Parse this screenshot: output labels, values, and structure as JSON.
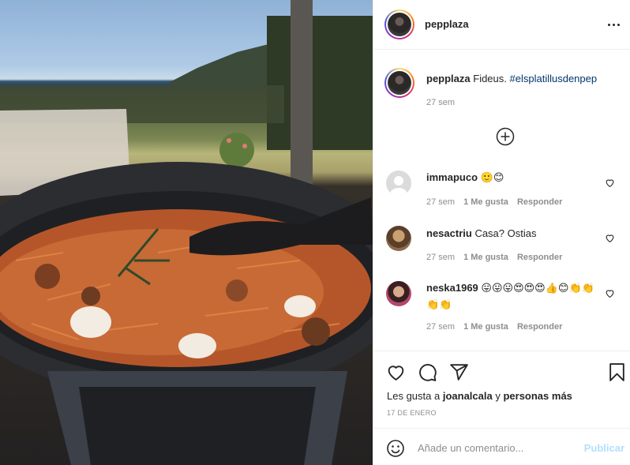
{
  "post": {
    "author": "pepplaza",
    "caption_text": "Fideus.",
    "caption_hashtag": "#elsplatillusdenpep",
    "caption_time": "27 sem"
  },
  "comments": [
    {
      "username": "immapuco",
      "text": "🙂😊",
      "time": "27 sem",
      "likes": "1 Me gusta",
      "reply": "Responder"
    },
    {
      "username": "nesactriu",
      "text": "Casa? Ostias",
      "time": "27 sem",
      "likes": "1 Me gusta",
      "reply": "Responder"
    },
    {
      "username": "neska1969",
      "text": "😛😛😛😍😍😍👍😊👏👏👏👏",
      "time": "27 sem",
      "likes": "1 Me gusta",
      "reply": "Responder"
    }
  ],
  "likes": {
    "prefix": "Les gusta a",
    "user": "joanalcala",
    "joiner": "y",
    "others": "personas más"
  },
  "post_date": "17 DE ENERO",
  "comment_box": {
    "placeholder": "Añade un comentario...",
    "publish_label": "Publicar"
  },
  "icons": {
    "more": "more-options-icon",
    "add_comments": "plus-circle-icon",
    "like": "heart-icon",
    "comment": "comment-icon",
    "share": "paper-plane-icon",
    "save": "bookmark-icon",
    "emoji": "emoji-icon"
  },
  "colors": {
    "link": "#00376b",
    "muted": "#8e8e8e",
    "publish_disabled": "#b2dffc"
  }
}
